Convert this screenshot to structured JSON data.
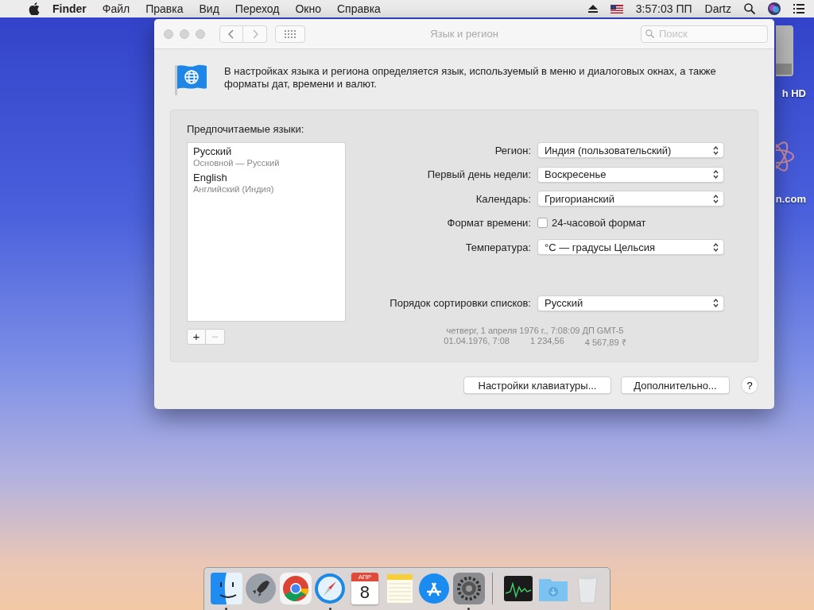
{
  "menu_bar": {
    "items": [
      {
        "label": "Finder",
        "kind": "app"
      },
      {
        "label": "Файл",
        "kind": "menu"
      },
      {
        "label": "Правка",
        "kind": "menu"
      },
      {
        "label": "Вид",
        "kind": "menu"
      },
      {
        "label": "Переход",
        "kind": "menu"
      },
      {
        "label": "Окно",
        "kind": "menu"
      },
      {
        "label": "Справка",
        "kind": "menu"
      }
    ],
    "time": "3:57:03 ПП",
    "user": "Dartz"
  },
  "desktop_icons": [
    {
      "label": "h HD",
      "kind": "disk"
    },
    {
      "label": "n.com",
      "kind": "logo"
    }
  ],
  "window": {
    "title": "Язык и регион",
    "search": {
      "placeholder": "Поиск"
    },
    "description": "В настройках языка и региона определяется язык, используемый в меню и диалоговых окнах, а также форматы дат, времени и валют.",
    "preferred_languages": {
      "label": "Предпочитаемые языки:",
      "languages": [
        {
          "name": "Русский",
          "detail": "Основной — Русский",
          "selected": false
        },
        {
          "name": "English",
          "detail": "Английский (Индия)",
          "selected": false
        }
      ],
      "list_buttons": [
        {
          "label": "+",
          "disabled": false
        },
        {
          "label": "−",
          "disabled": true
        }
      ]
    },
    "settings": [
      {
        "kind": "popup",
        "label": "Регион:",
        "value": "Индия (пользовательский)"
      },
      {
        "kind": "popup",
        "label": "Первый день недели:",
        "value": "Воскресенье"
      },
      {
        "kind": "popup",
        "label": "Календарь:",
        "value": "Григорианский"
      },
      {
        "kind": "checkbox",
        "label": "Формат времени:",
        "value": "24-часовой формат",
        "checked": false
      },
      {
        "kind": "popup",
        "label": "Температура:",
        "value": "°C — градусы Цельсия"
      }
    ],
    "sort_order": {
      "label": "Порядок сортировки списков:",
      "value": "Русский"
    },
    "preview": {
      "line_1": "четверг, 1 апреля 1976 г., 7:08:09 ДП GMT-5",
      "line_2": [
        "01.04.1976, 7:08",
        "1 234,56",
        "4 567,89 ₹"
      ]
    },
    "buttons": [
      "Настройки клавиатуры...",
      "Дополнительно..."
    ],
    "help": "?"
  },
  "dock": {
    "items": [
      {
        "kind": "finder",
        "running": true
      },
      {
        "kind": "launchpad",
        "running": false
      },
      {
        "kind": "chrome",
        "running": false
      },
      {
        "kind": "safari",
        "running": true
      },
      {
        "kind": "calendar",
        "running": false,
        "month": "АПР",
        "day": "8"
      },
      {
        "kind": "notes",
        "running": false
      },
      {
        "kind": "appstore",
        "running": false
      },
      {
        "kind": "settings",
        "running": true
      },
      {
        "kind": "divider"
      },
      {
        "kind": "monitor",
        "running": false
      },
      {
        "kind": "downloads",
        "running": false
      },
      {
        "kind": "trash",
        "running": false
      }
    ]
  }
}
